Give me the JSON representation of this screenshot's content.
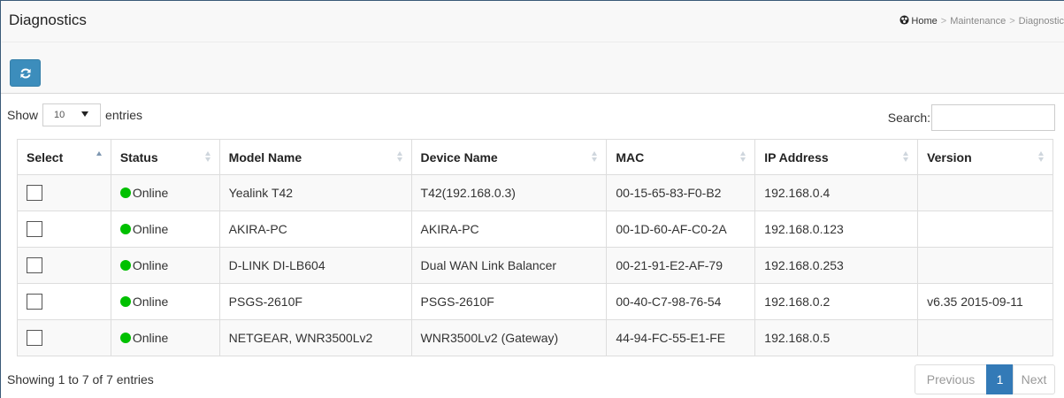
{
  "header": {
    "title": "Diagnostics",
    "breadcrumb": [
      "Home",
      "Maintenance",
      "Diagnostic"
    ],
    "refresh_icon": "refresh-icon"
  },
  "colors": {
    "refresh_button": "#3c8dbc",
    "online_dot": "#00c000",
    "active_page": "#337ab7"
  },
  "controls": {
    "show_label": "Show",
    "page_length": "10",
    "entries_label": "entries",
    "search_label": "Search:",
    "search_value": ""
  },
  "table": {
    "columns": [
      "Select",
      "Status",
      "Model Name",
      "Device Name",
      "MAC",
      "IP Address",
      "Version"
    ],
    "sorted_column": "Select",
    "sort_direction": "ascending",
    "rows": [
      {
        "selected": false,
        "status": "Online",
        "model": "Yealink T42",
        "device": "T42(192.168.0.3)",
        "mac": "00-15-65-83-F0-B2",
        "ip": "192.168.0.4",
        "version": ""
      },
      {
        "selected": false,
        "status": "Online",
        "model": "AKIRA-PC",
        "device": "AKIRA-PC",
        "mac": "00-1D-60-AF-C0-2A",
        "ip": "192.168.0.123",
        "version": ""
      },
      {
        "selected": false,
        "status": "Online",
        "model": "D-LINK DI-LB604",
        "device": "Dual WAN Link Balancer",
        "mac": "00-21-91-E2-AF-79",
        "ip": "192.168.0.253",
        "version": ""
      },
      {
        "selected": false,
        "status": "Online",
        "model": "PSGS-2610F",
        "device": "PSGS-2610F",
        "mac": "00-40-C7-98-76-54",
        "ip": "192.168.0.2",
        "version": "v6.35 2015-09-11"
      },
      {
        "selected": false,
        "status": "Online",
        "model": "NETGEAR, WNR3500Lv2",
        "device": "WNR3500Lv2 (Gateway)",
        "mac": "44-94-FC-55-E1-FE",
        "ip": "192.168.0.5",
        "version": ""
      }
    ]
  },
  "footer": {
    "info": "Showing 1 to 7 of 7 entries",
    "previous_label": "Previous",
    "current_page": "1",
    "next_label": "Next"
  }
}
